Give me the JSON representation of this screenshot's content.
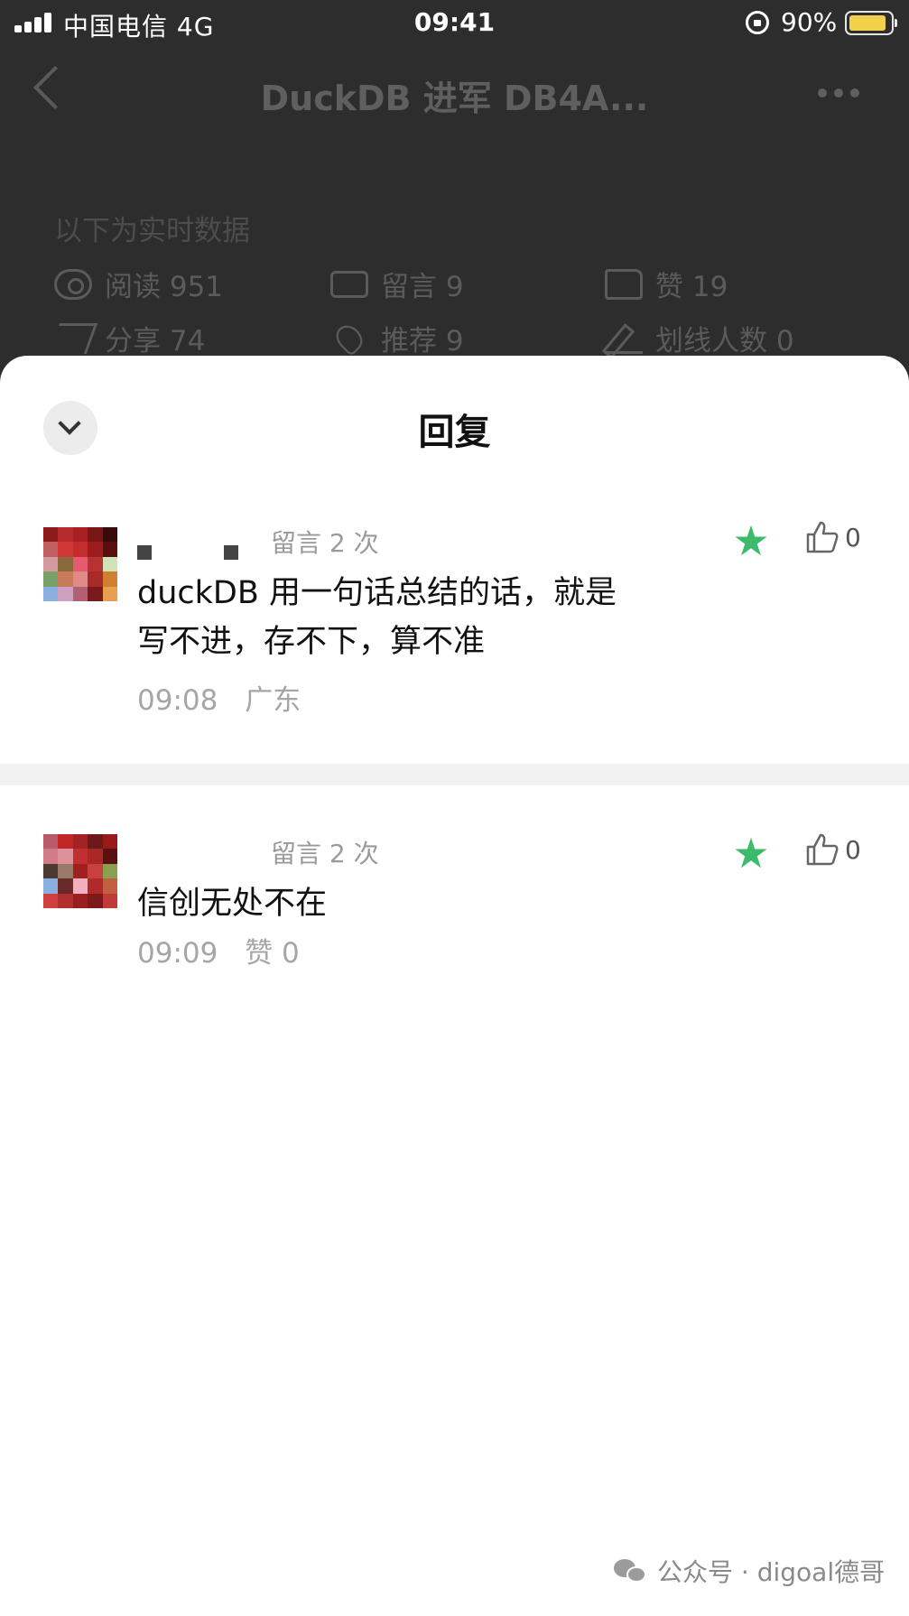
{
  "status_bar": {
    "carrier": "中国电信  4G",
    "time": "09:41",
    "battery_percent": "90%",
    "battery_level": 0.9
  },
  "nav": {
    "title": "DuckDB 进军 DB4A..."
  },
  "stats": {
    "caption": "以下为实时数据",
    "items": [
      {
        "icon": "eye-icon",
        "label": "阅读 951"
      },
      {
        "icon": "comment-bubble-icon",
        "label": "留言 9"
      },
      {
        "icon": "thumbs-up-icon",
        "label": "赞 19"
      },
      {
        "icon": "share-icon",
        "label": "分享 74"
      },
      {
        "icon": "heart-icon",
        "label": "推荐 9"
      },
      {
        "icon": "pen-icon",
        "label": "划线人数 0"
      }
    ]
  },
  "sheet": {
    "title": "回复"
  },
  "comments": [
    {
      "msg_count": "留言 2 次",
      "text_line1": "duckDB 用一句话总结的话，就是",
      "text_line2": "写不进，存不下，算不准",
      "time": "09:08",
      "location": "广东",
      "likes": "0"
    },
    {
      "msg_count": "留言 2 次",
      "text_line1": "信创无处不在",
      "time": "09:09",
      "location": "赞 0",
      "likes": "0"
    }
  ],
  "colors": {
    "star": "#3dba6b",
    "dark_bg": "#2d2d2d",
    "battery": "#f3d04a"
  },
  "watermark": "公众号 · digoal德哥"
}
